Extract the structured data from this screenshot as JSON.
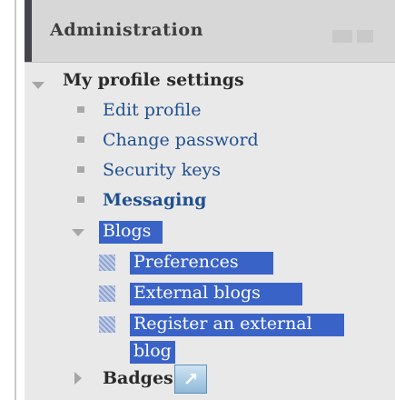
{
  "block": {
    "title": "Administration"
  },
  "nav": {
    "my_profile_settings": "My profile settings",
    "edit_profile": "Edit profile",
    "change_password": "Change password",
    "security_keys": "Security keys",
    "messaging": "Messaging",
    "blogs": "Blogs",
    "preferences": "Preferences",
    "external_blogs": "External blogs",
    "register_external_line1": "Register an external",
    "register_external_line2": "blog",
    "badges": "Badges"
  },
  "icons": {
    "header_controls": [
      "dock-icon",
      "hide-block-icon"
    ],
    "expanded": "triangle-down-icon",
    "collapsed": "triangle-right-icon",
    "leaf": "bullet-icon",
    "badge_link": "arrow-upright-icon"
  },
  "colors": {
    "link": "#1f4f8f",
    "selection": "#3a63c8",
    "block_background": "#e9e9e9",
    "header_background": "#d7d7d7"
  }
}
